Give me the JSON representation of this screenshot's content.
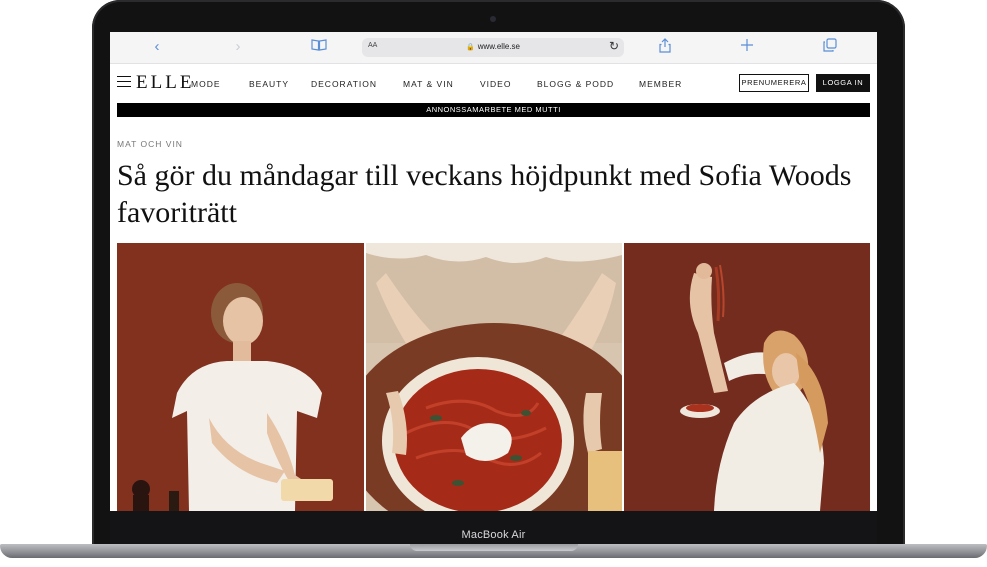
{
  "browser": {
    "address": {
      "aa_label": "AA",
      "url": "www.elle.se",
      "lock_icon": "lock-icon",
      "reload_icon": "reload-icon"
    },
    "icons": [
      "back-icon",
      "forward-icon",
      "reader-icon",
      "share-icon",
      "new-tab-icon",
      "tabs-icon"
    ]
  },
  "site": {
    "logo": "ELLE",
    "nav": [
      {
        "label": "MODE"
      },
      {
        "label": "BEAUTY"
      },
      {
        "label": "DECORATION"
      },
      {
        "label": "MAT & VIN"
      },
      {
        "label": "VIDEO"
      },
      {
        "label": "BLOGG & PODD"
      },
      {
        "label": "MEMBER"
      }
    ],
    "subscribe_label": "PRENUMERERA",
    "login_label": "LOGGA IN",
    "sponsor_text": "ANNONSSAMARBETE MED MUTTI"
  },
  "article": {
    "category": "MAT OCH VIN",
    "headline": "Så gör du måndagar till veckans höjdpunkt med Sofia Woods favoriträtt"
  },
  "device": {
    "model_label": "MacBook Air"
  },
  "colors": {
    "photo_background": "#7e2f20",
    "accent_link": "#5a8fd6"
  }
}
